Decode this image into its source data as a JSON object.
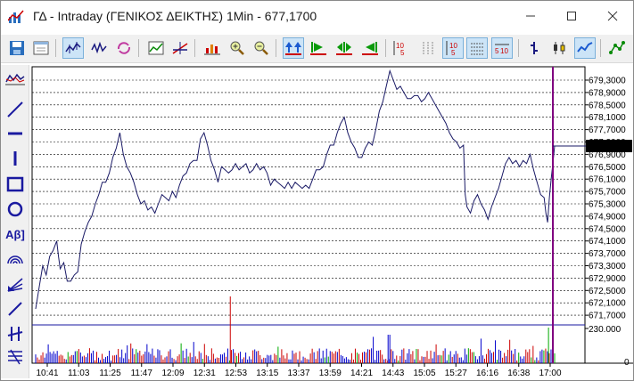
{
  "window": {
    "title": "ΓΔ - Intraday (ΓΕΝΙΚΟΣ ΔΕΙΚΤΗΣ) 1Min - 677,1700",
    "minimize_icon": "minimize-icon",
    "maximize_icon": "maximize-icon",
    "close_icon": "close-icon"
  },
  "colors": {
    "price_line": "#1a1a66",
    "grid": "#000000",
    "volume_up": "#0000cc",
    "volume_down": "#cc0000",
    "volume_flat": "#00aa00",
    "cursor_line": "#800080",
    "last_price_box": "#000000"
  },
  "toolbar": {
    "icons": [
      "save-icon",
      "window-icon",
      "line-chart-icon",
      "candle-chart-icon",
      "refresh-icon",
      "chart-settings-icon",
      "trend-icon",
      "bars-icon",
      "zoom-in-icon",
      "zoom-out-icon",
      "scroll-both-icon",
      "go-start-icon",
      "play-icon",
      "go-end-icon",
      "period-5-icon",
      "grid-icon",
      "range-10-5-icon",
      "table-icon",
      "range-5-10-icon",
      "bar-type-icon",
      "candle-type-icon",
      "line-type-icon",
      "indicator-icon"
    ]
  },
  "side_tools": {
    "icons": [
      "indicator-panel-icon",
      "diagonal-line-icon",
      "horizontal-line-icon",
      "vertical-line-icon",
      "rectangle-icon",
      "ellipse-icon",
      "text-tool-icon",
      "arc-icon",
      "fan-icon",
      "pen-icon",
      "cross-icon",
      "fibonacci-icon"
    ],
    "text_label": "Aβ]"
  },
  "chart_data": {
    "type": "line",
    "y_ticks": [
      "679,3000",
      "678,9000",
      "678,5000",
      "678,1000",
      "677,7000",
      "677,3000",
      "676,9000",
      "676,5000",
      "676,1000",
      "675,7000",
      "675,3000",
      "674,9000",
      "674,5000",
      "674,1000",
      "673,7000",
      "673,3000",
      "672,9000",
      "672,5000",
      "672,1000",
      "671,7000"
    ],
    "ylim": [
      671.5,
      679.7
    ],
    "last_price_label": "677,1700",
    "last_price": 677.17,
    "volume_ticks": [
      "230.000",
      "0"
    ],
    "x_ticks": [
      "10:41",
      "11:03",
      "11:25",
      "11:47",
      "12:09",
      "12:31",
      "12:53",
      "13:15",
      "13:37",
      "13:59",
      "14:21",
      "14:43",
      "15:05",
      "15:27",
      "16:16",
      "16:38",
      "17:00"
    ],
    "price": [
      [
        0,
        671.9
      ],
      [
        4,
        672.6
      ],
      [
        8,
        673.3
      ],
      [
        12,
        673.0
      ],
      [
        16,
        673.6
      ],
      [
        20,
        673.8
      ],
      [
        24,
        674.1
      ],
      [
        26,
        673.6
      ],
      [
        28,
        673.2
      ],
      [
        32,
        673.4
      ],
      [
        36,
        672.8
      ],
      [
        40,
        672.8
      ],
      [
        44,
        673.0
      ],
      [
        48,
        673.1
      ],
      [
        52,
        674.0
      ],
      [
        56,
        674.4
      ],
      [
        60,
        674.7
      ],
      [
        64,
        674.9
      ],
      [
        68,
        675.3
      ],
      [
        72,
        675.6
      ],
      [
        76,
        676.0
      ],
      [
        80,
        676.0
      ],
      [
        84,
        676.3
      ],
      [
        88,
        676.8
      ],
      [
        92,
        677.1
      ],
      [
        96,
        677.6
      ],
      [
        100,
        676.9
      ],
      [
        104,
        676.5
      ],
      [
        108,
        676.3
      ],
      [
        112,
        676.0
      ],
      [
        116,
        675.6
      ],
      [
        120,
        675.3
      ],
      [
        124,
        675.4
      ],
      [
        128,
        675.1
      ],
      [
        132,
        675.2
      ],
      [
        136,
        675.0
      ],
      [
        140,
        675.3
      ],
      [
        144,
        675.6
      ],
      [
        148,
        675.5
      ],
      [
        152,
        675.4
      ],
      [
        156,
        675.7
      ],
      [
        160,
        675.5
      ],
      [
        164,
        675.9
      ],
      [
        168,
        676.2
      ],
      [
        172,
        676.3
      ],
      [
        176,
        676.6
      ],
      [
        180,
        676.7
      ],
      [
        184,
        676.7
      ],
      [
        188,
        677.4
      ],
      [
        192,
        677.6
      ],
      [
        196,
        677.2
      ],
      [
        200,
        676.7
      ],
      [
        204,
        676.4
      ],
      [
        208,
        676.0
      ],
      [
        212,
        676.5
      ],
      [
        216,
        676.4
      ],
      [
        220,
        676.3
      ],
      [
        224,
        676.4
      ],
      [
        228,
        676.6
      ],
      [
        232,
        676.4
      ],
      [
        236,
        676.5
      ],
      [
        240,
        676.6
      ],
      [
        244,
        676.3
      ],
      [
        248,
        676.4
      ],
      [
        252,
        676.6
      ],
      [
        256,
        676.4
      ],
      [
        260,
        676.5
      ],
      [
        264,
        676.3
      ],
      [
        268,
        675.9
      ],
      [
        272,
        676.1
      ],
      [
        276,
        676.0
      ],
      [
        280,
        675.9
      ],
      [
        284,
        675.8
      ],
      [
        288,
        676.0
      ],
      [
        292,
        675.8
      ],
      [
        296,
        676.0
      ],
      [
        300,
        675.9
      ],
      [
        304,
        675.8
      ],
      [
        308,
        675.9
      ],
      [
        312,
        675.8
      ],
      [
        316,
        676.1
      ],
      [
        320,
        676.4
      ],
      [
        324,
        676.4
      ],
      [
        328,
        676.5
      ],
      [
        332,
        676.9
      ],
      [
        336,
        677.2
      ],
      [
        340,
        677.2
      ],
      [
        344,
        677.6
      ],
      [
        348,
        677.9
      ],
      [
        352,
        678.1
      ],
      [
        356,
        677.6
      ],
      [
        360,
        677.3
      ],
      [
        364,
        677.1
      ],
      [
        368,
        676.8
      ],
      [
        372,
        676.8
      ],
      [
        376,
        677.1
      ],
      [
        380,
        677.3
      ],
      [
        384,
        677.2
      ],
      [
        388,
        677.7
      ],
      [
        392,
        678.3
      ],
      [
        396,
        678.6
      ],
      [
        400,
        679.1
      ],
      [
        404,
        679.6
      ],
      [
        408,
        679.3
      ],
      [
        412,
        679.0
      ],
      [
        416,
        679.1
      ],
      [
        420,
        678.9
      ],
      [
        424,
        678.7
      ],
      [
        428,
        678.7
      ],
      [
        432,
        678.8
      ],
      [
        436,
        678.8
      ],
      [
        440,
        678.6
      ],
      [
        444,
        678.7
      ],
      [
        448,
        678.9
      ],
      [
        452,
        678.7
      ],
      [
        456,
        678.5
      ],
      [
        460,
        678.3
      ],
      [
        464,
        678.1
      ],
      [
        468,
        677.9
      ],
      [
        472,
        677.6
      ],
      [
        476,
        677.4
      ],
      [
        480,
        677.3
      ],
      [
        484,
        677.1
      ],
      [
        488,
        677.2
      ],
      [
        490,
        675.6
      ],
      [
        492,
        675.2
      ],
      [
        496,
        675.0
      ],
      [
        500,
        675.4
      ],
      [
        504,
        675.6
      ],
      [
        508,
        675.3
      ],
      [
        512,
        675.1
      ],
      [
        516,
        674.8
      ],
      [
        520,
        675.2
      ],
      [
        524,
        675.5
      ],
      [
        528,
        675.8
      ],
      [
        532,
        676.2
      ],
      [
        536,
        676.6
      ],
      [
        540,
        676.8
      ],
      [
        544,
        676.6
      ],
      [
        548,
        676.7
      ],
      [
        552,
        676.5
      ],
      [
        556,
        676.7
      ],
      [
        560,
        676.6
      ],
      [
        564,
        676.9
      ],
      [
        568,
        676.4
      ],
      [
        572,
        676.0
      ],
      [
        576,
        675.6
      ],
      [
        580,
        675.5
      ],
      [
        582,
        675.0
      ],
      [
        584,
        674.7
      ],
      [
        586,
        675.5
      ],
      [
        588,
        676.1
      ],
      [
        590,
        676.6
      ],
      [
        592,
        677.17
      ]
    ],
    "volume_x": [
      0,
      220,
      400,
      582,
      588,
      592
    ],
    "volume_note": ""
  }
}
